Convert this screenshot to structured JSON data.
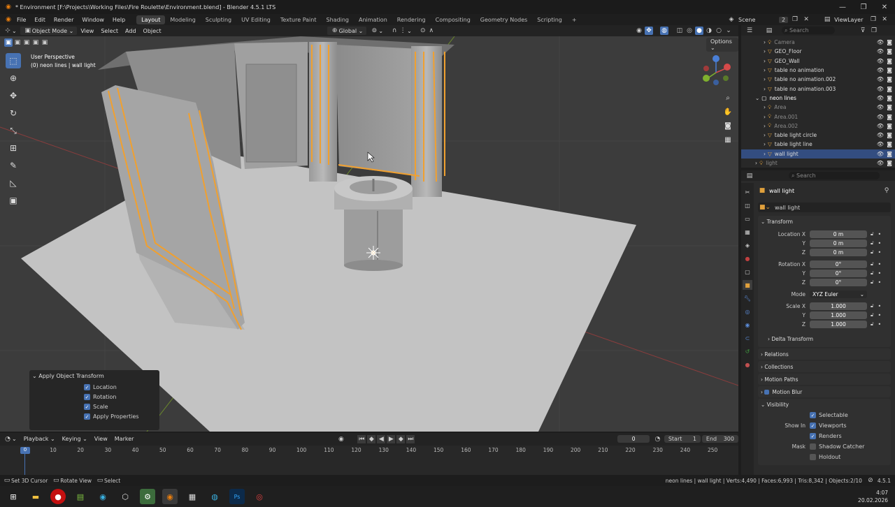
{
  "window": {
    "title": "* Environment [F:\\Projects\\Working Files\\Fire Roulette\\Environment.blend] - Blender 4.5.1 LTS"
  },
  "menu": {
    "items": [
      "File",
      "Edit",
      "Render",
      "Window",
      "Help"
    ]
  },
  "workspaces": [
    "Layout",
    "Modeling",
    "Sculpting",
    "UV Editing",
    "Texture Paint",
    "Shading",
    "Animation",
    "Rendering",
    "Compositing",
    "Geometry Nodes",
    "Scripting"
  ],
  "scene": {
    "label": "Scene",
    "count": "2",
    "viewlayer": "ViewLayer"
  },
  "viewport_header": {
    "mode": "Object Mode",
    "menus": [
      "View",
      "Select",
      "Add",
      "Object"
    ],
    "orientation": "Global",
    "options": "Options"
  },
  "viewport": {
    "view_name": "User Perspective",
    "selection": "(0) neon lines | wall light"
  },
  "operator": {
    "title": "Apply Object Transform",
    "options": [
      {
        "label": "Location",
        "checked": true
      },
      {
        "label": "Rotation",
        "checked": true
      },
      {
        "label": "Scale",
        "checked": true
      },
      {
        "label": "Apply Properties",
        "checked": true
      }
    ]
  },
  "timeline": {
    "menus": [
      "Playback",
      "Keying",
      "View",
      "Marker"
    ],
    "current": "0",
    "start_label": "Start",
    "start": "1",
    "end_label": "End",
    "end": "300",
    "ticks": [
      "0",
      "10",
      "20",
      "30",
      "40",
      "50",
      "60",
      "70",
      "80",
      "90",
      "100",
      "110",
      "120",
      "130",
      "140",
      "150",
      "160",
      "170",
      "180",
      "190",
      "200",
      "210",
      "220",
      "230",
      "240",
      "250"
    ]
  },
  "statusbar": {
    "left": [
      "Set 3D Cursor",
      "Rotate View",
      "Select"
    ],
    "right": "neon lines | wall light | Verts:4,490 | Faces:6,993 | Tris:8,342 | Objects:2/10",
    "version": "4.5.1"
  },
  "taskbar": {
    "time": "4:07",
    "date": "20.02.2026"
  },
  "outliner": {
    "search_placeholder": "Search",
    "rows": [
      {
        "label": "Camera",
        "indent": 1,
        "dim": true
      },
      {
        "label": "GEO_Floor",
        "indent": 1
      },
      {
        "label": "GEO_Wall",
        "indent": 1
      },
      {
        "label": "table no animation",
        "indent": 1
      },
      {
        "label": "table no animation.002",
        "indent": 1
      },
      {
        "label": "table no animation.003",
        "indent": 1
      },
      {
        "label": "neon lines",
        "indent": 0,
        "collection": true
      },
      {
        "label": "Area",
        "indent": 1,
        "dim": true
      },
      {
        "label": "Area.001",
        "indent": 1,
        "dim": true
      },
      {
        "label": "Area.002",
        "indent": 1,
        "dim": true
      },
      {
        "label": "table light circle",
        "indent": 1
      },
      {
        "label": "table light line",
        "indent": 1
      },
      {
        "label": "wall light",
        "indent": 1,
        "selected": true
      },
      {
        "label": "light",
        "indent": 0,
        "dim": true
      }
    ]
  },
  "properties": {
    "search_placeholder": "Search",
    "object_name": "wall light",
    "data_name": "wall light",
    "transform_label": "Transform",
    "location": {
      "label": "Location X",
      "x": "0 m",
      "y": "0 m",
      "z": "0 m"
    },
    "rotation": {
      "label": "Rotation X",
      "x": "0°",
      "y": "0°",
      "z": "0°"
    },
    "mode": {
      "label": "Mode",
      "value": "XYZ Euler"
    },
    "scale": {
      "label": "Scale X",
      "x": "1.000",
      "y": "1.000",
      "z": "1.000"
    },
    "axis": {
      "y": "Y",
      "z": "Z"
    },
    "delta": "Delta Transform",
    "relations": "Relations",
    "collections": "Collections",
    "motion_paths": "Motion Paths",
    "motion_blur": "Motion Blur",
    "visibility": "Visibility",
    "selectable": "Selectable",
    "show_in": "Show In",
    "viewports": "Viewports",
    "renders": "Renders",
    "mask": "Mask",
    "shadow_catcher": "Shadow Catcher",
    "holdout": "Holdout"
  },
  "colors": {
    "selected_outline": "#f0a030",
    "accent": "#4772b3",
    "floor": "#c2c2c2",
    "wall": "#9a9a9a"
  }
}
